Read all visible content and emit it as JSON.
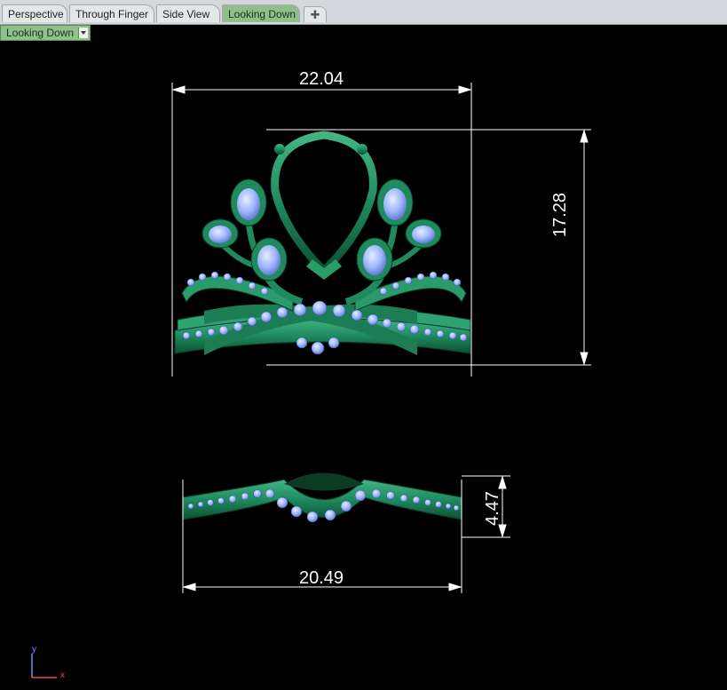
{
  "tabs": [
    {
      "label": "Perspective",
      "active": false
    },
    {
      "label": "Through Finger",
      "active": false
    },
    {
      "label": "Side View",
      "active": false
    },
    {
      "label": "Looking Down",
      "active": true
    }
  ],
  "add_tab_icon": "plus-icon",
  "viewport": {
    "label": "Looking Down",
    "dropdown_icon": "triangle-down-icon"
  },
  "dimensions": {
    "front_width": "22.04",
    "front_height": "17.28",
    "top_width": "20.49",
    "top_height": "4.47"
  },
  "axis": {
    "y": "y",
    "x": "x"
  },
  "colors": {
    "active_tab": "#8fc08b",
    "metal": "#1f8a5e",
    "stones": "#9fb6ff",
    "background": "#000000"
  }
}
